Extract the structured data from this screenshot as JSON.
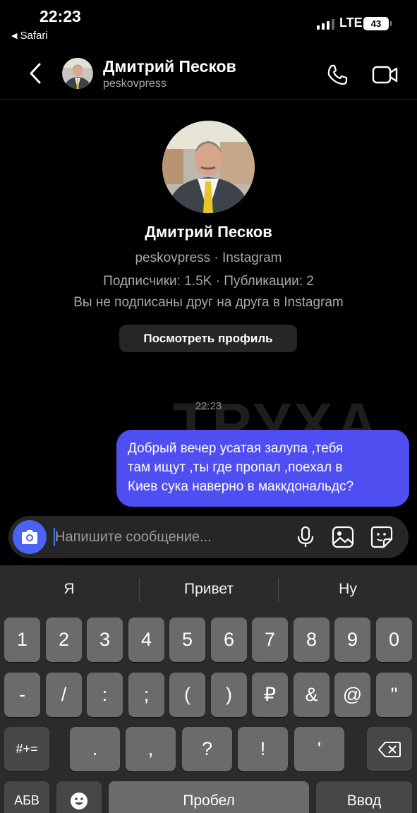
{
  "status": {
    "time": "22:23",
    "back_app": "Safari",
    "network": "LTE",
    "battery": "43"
  },
  "header": {
    "name": "Дмитрий Песков",
    "username": "peskovpress"
  },
  "profile": {
    "name": "Дмитрий Песков",
    "subtitle": "peskovpress · Instagram",
    "stats": "Подписчики: 1.5K · Публикации: 2",
    "relation": "Вы не подписаны друг на друга в Instagram",
    "view_button": "Посмотреть профиль"
  },
  "watermark": "ТРУХА",
  "chat": {
    "timestamp": "22:23",
    "message_lines": [
      "Добрый вечер усатая залупа ,тебя",
      "там ищут ,ты где пропал ,поехал в",
      "Киев сука наверно в маккдональдс?"
    ]
  },
  "composer": {
    "placeholder": "Напишите сообщение..."
  },
  "keyboard": {
    "suggestions": [
      "Я",
      "Привет",
      "Ну"
    ],
    "row1": [
      "1",
      "2",
      "3",
      "4",
      "5",
      "6",
      "7",
      "8",
      "9",
      "0"
    ],
    "row2": [
      "-",
      "/",
      ":",
      ";",
      "(",
      ")",
      "₽",
      "&",
      "@",
      "\""
    ],
    "row3_mode": "#+=",
    "row3": [
      ".",
      ",",
      "?",
      "!",
      "'"
    ],
    "abc": "АБВ",
    "space": "Пробел",
    "enter": "Ввод"
  },
  "icons": [
    "back-chevron-icon",
    "phone-icon",
    "video-camera-icon",
    "camera-icon",
    "microphone-icon",
    "gallery-icon",
    "sticker-icon",
    "emoji-icon",
    "backspace-icon"
  ],
  "colors": {
    "bubble": "#4f4ef0",
    "camera_button": "#4d61f5",
    "background": "#000000"
  }
}
